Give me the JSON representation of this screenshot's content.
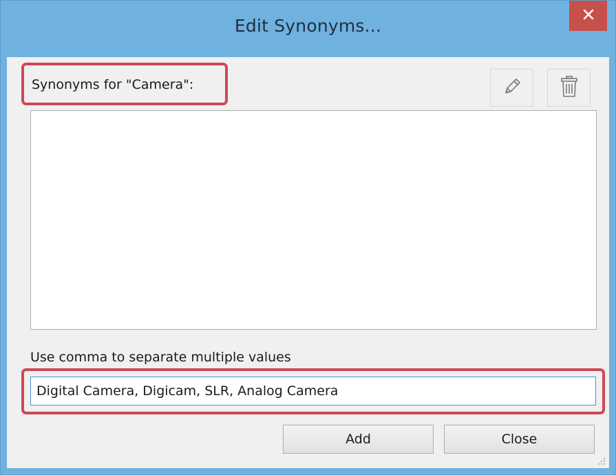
{
  "window": {
    "title": "Edit Synonyms...",
    "accent_color": "#6fb2e0",
    "close_color": "#c7504a",
    "close_icon": "close-icon"
  },
  "synonyms": {
    "label": "Synonyms for \"Camera\":",
    "highlight_color": "#cc4a56",
    "toolbar": {
      "edit_icon": "pencil-icon",
      "delete_icon": "trash-icon"
    },
    "items": []
  },
  "input": {
    "hint": "Use comma to separate multiple values",
    "value": "Digital Camera, Digicam, SLR, Analog Camera"
  },
  "buttons": {
    "add_label": "Add",
    "close_label": "Close"
  }
}
